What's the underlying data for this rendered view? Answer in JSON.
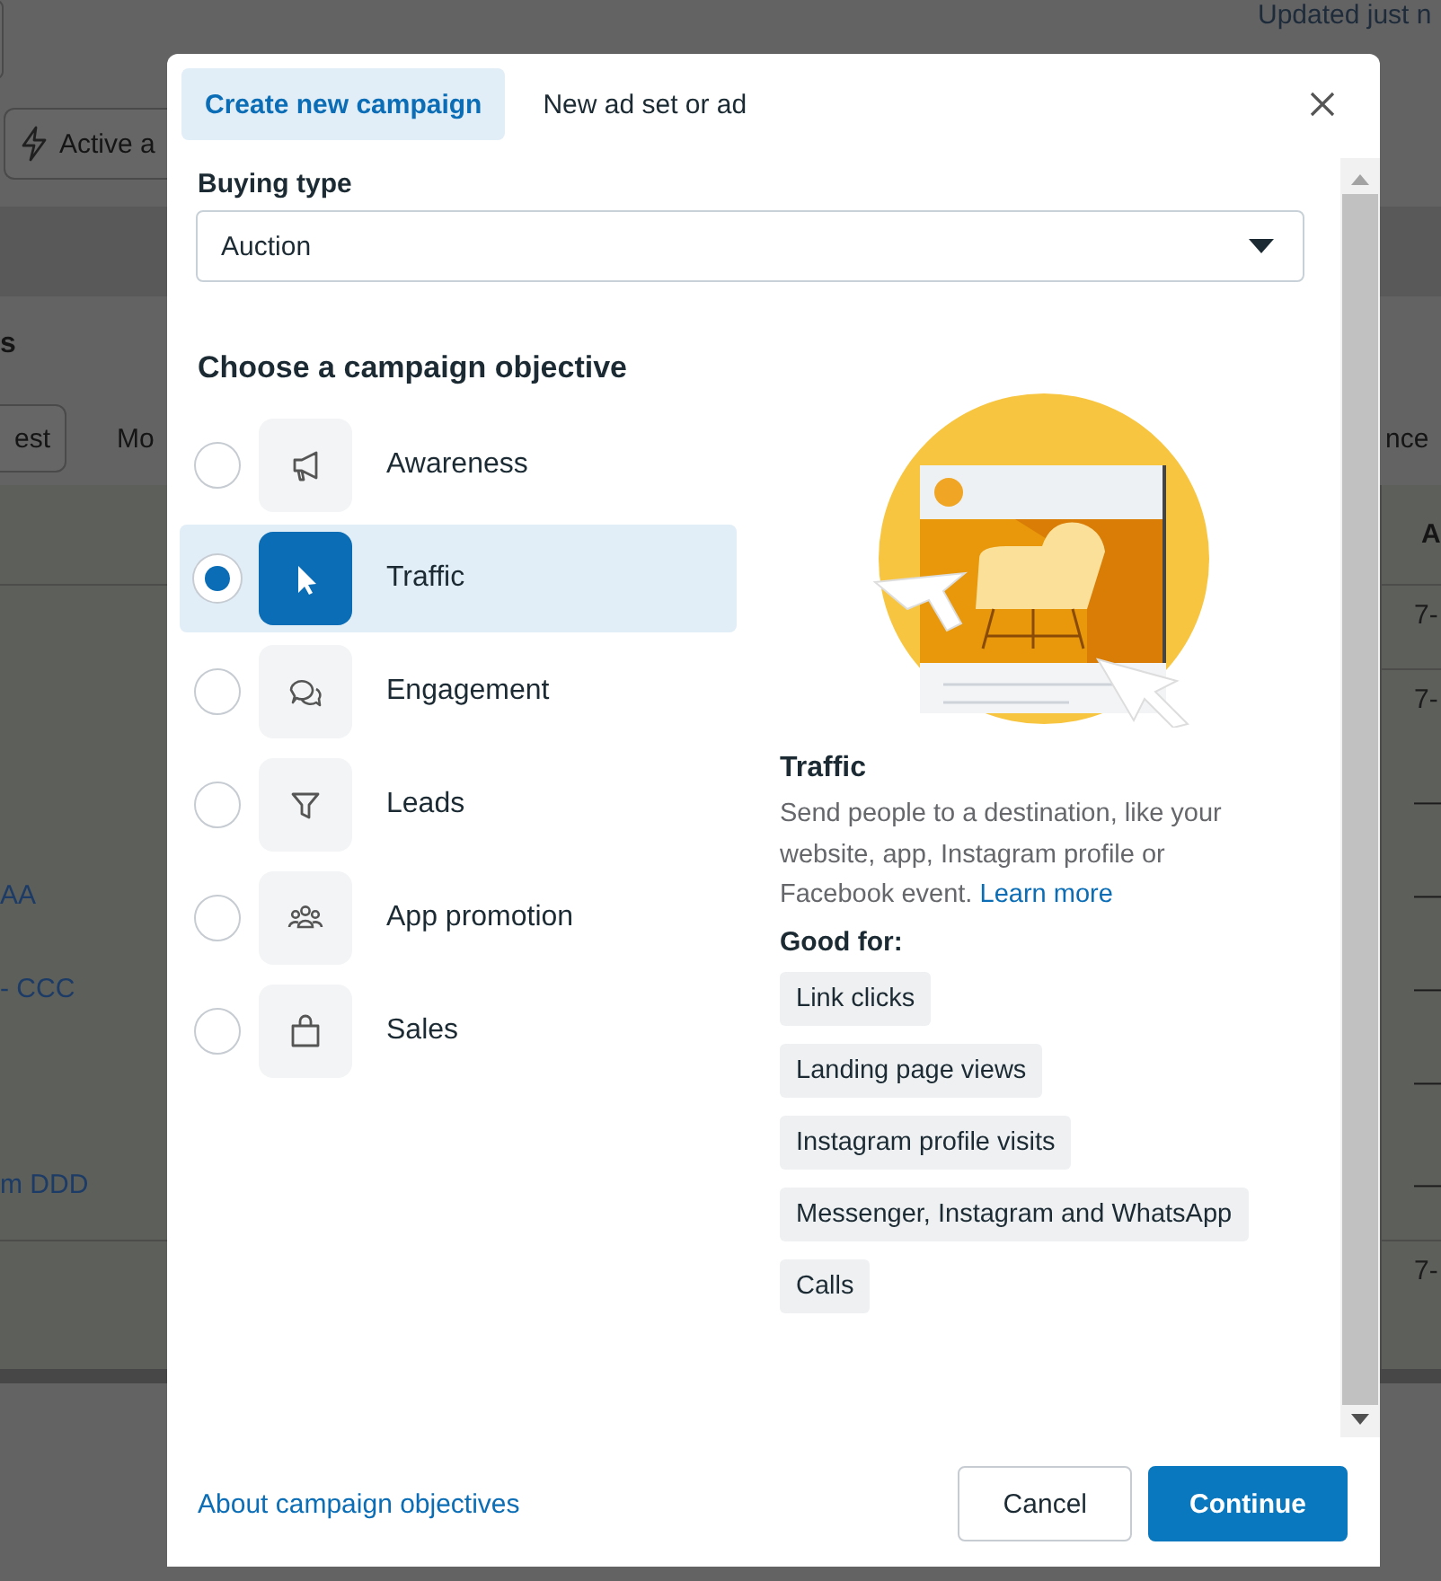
{
  "background_page": {
    "updated_text": "Updated just n",
    "active_button": "Active a",
    "section_heading": "s",
    "left_buttons": [
      "est",
      "Mo"
    ],
    "right_tab": "nce",
    "column_header": "A",
    "rows": [
      {
        "right_cell": "7-"
      },
      {
        "right_cell": "7-"
      },
      {
        "right_cell": "—"
      },
      {
        "left_link": "AA",
        "right_cell": "—"
      },
      {
        "left_link": "- CCC",
        "right_cell": "—"
      },
      {
        "right_cell": "—"
      },
      {
        "left_link": "m DDD",
        "right_cell": "—"
      },
      {
        "right_cell": "7-"
      }
    ]
  },
  "dialog": {
    "tabs": [
      {
        "label": "Create new campaign",
        "selected": true
      },
      {
        "label": "New ad set or ad",
        "selected": false
      }
    ],
    "buying_type": {
      "label": "Buying type",
      "value": "Auction"
    },
    "objective_heading": "Choose a campaign objective",
    "objectives": [
      {
        "label": "Awareness",
        "selected": false
      },
      {
        "label": "Traffic",
        "selected": true
      },
      {
        "label": "Engagement",
        "selected": false
      },
      {
        "label": "Leads",
        "selected": false
      },
      {
        "label": "App promotion",
        "selected": false
      },
      {
        "label": "Sales",
        "selected": false
      }
    ],
    "detail": {
      "title": "Traffic",
      "description": "Send people to a destination, like your website, app, Instagram profile or Facebook event.",
      "learn_more_link": "Learn more",
      "good_for_label": "Good for:",
      "good_for": [
        "Link clicks",
        "Landing page views",
        "Instagram profile visits",
        "Messenger, Instagram and WhatsApp",
        "Calls"
      ]
    },
    "footer": {
      "link": "About campaign objectives",
      "buttons": [
        {
          "label": "Cancel",
          "kind": "secondary"
        },
        {
          "label": "Continue",
          "kind": "primary"
        }
      ]
    }
  }
}
